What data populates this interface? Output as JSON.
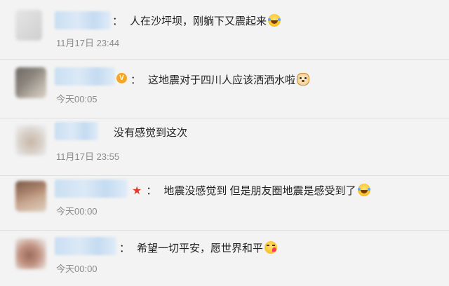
{
  "comments": [
    {
      "colon": "：",
      "text": "人在沙坪坝，刚躺下又震起来",
      "time": "11月17日 23:44"
    },
    {
      "colon": "：",
      "text": "这地震对于四川人应该洒洒水啦",
      "time": "今天00:05"
    },
    {
      "colon": "",
      "text": "没有感觉到这次",
      "time": "11月17日 23:55"
    },
    {
      "colon": "：",
      "text": "地震没感觉到 但是朋友圈地震是感受到了",
      "time": "今天00:00"
    },
    {
      "colon": "：",
      "text": "希望一切平安，愿世界和平",
      "time": "今天00:00"
    }
  ],
  "colors": {
    "background": "#f3f3f3",
    "divider": "#dfdfdf",
    "timestamp": "#8a8a8a",
    "name_blur": "#c9dff3",
    "star": "#e03b2c",
    "vip": "#f5a623"
  },
  "icons": {
    "c1_emoji": "laughing-tears-emoji-icon",
    "c2_badge": "vip-badge-icon",
    "c2_emoji": "dog-face-emoji-icon",
    "c4_badge": "star-icon",
    "c4_emoji": "laughing-tears-emoji-icon",
    "c5_emoji": "kiss-heart-emoji-icon"
  }
}
